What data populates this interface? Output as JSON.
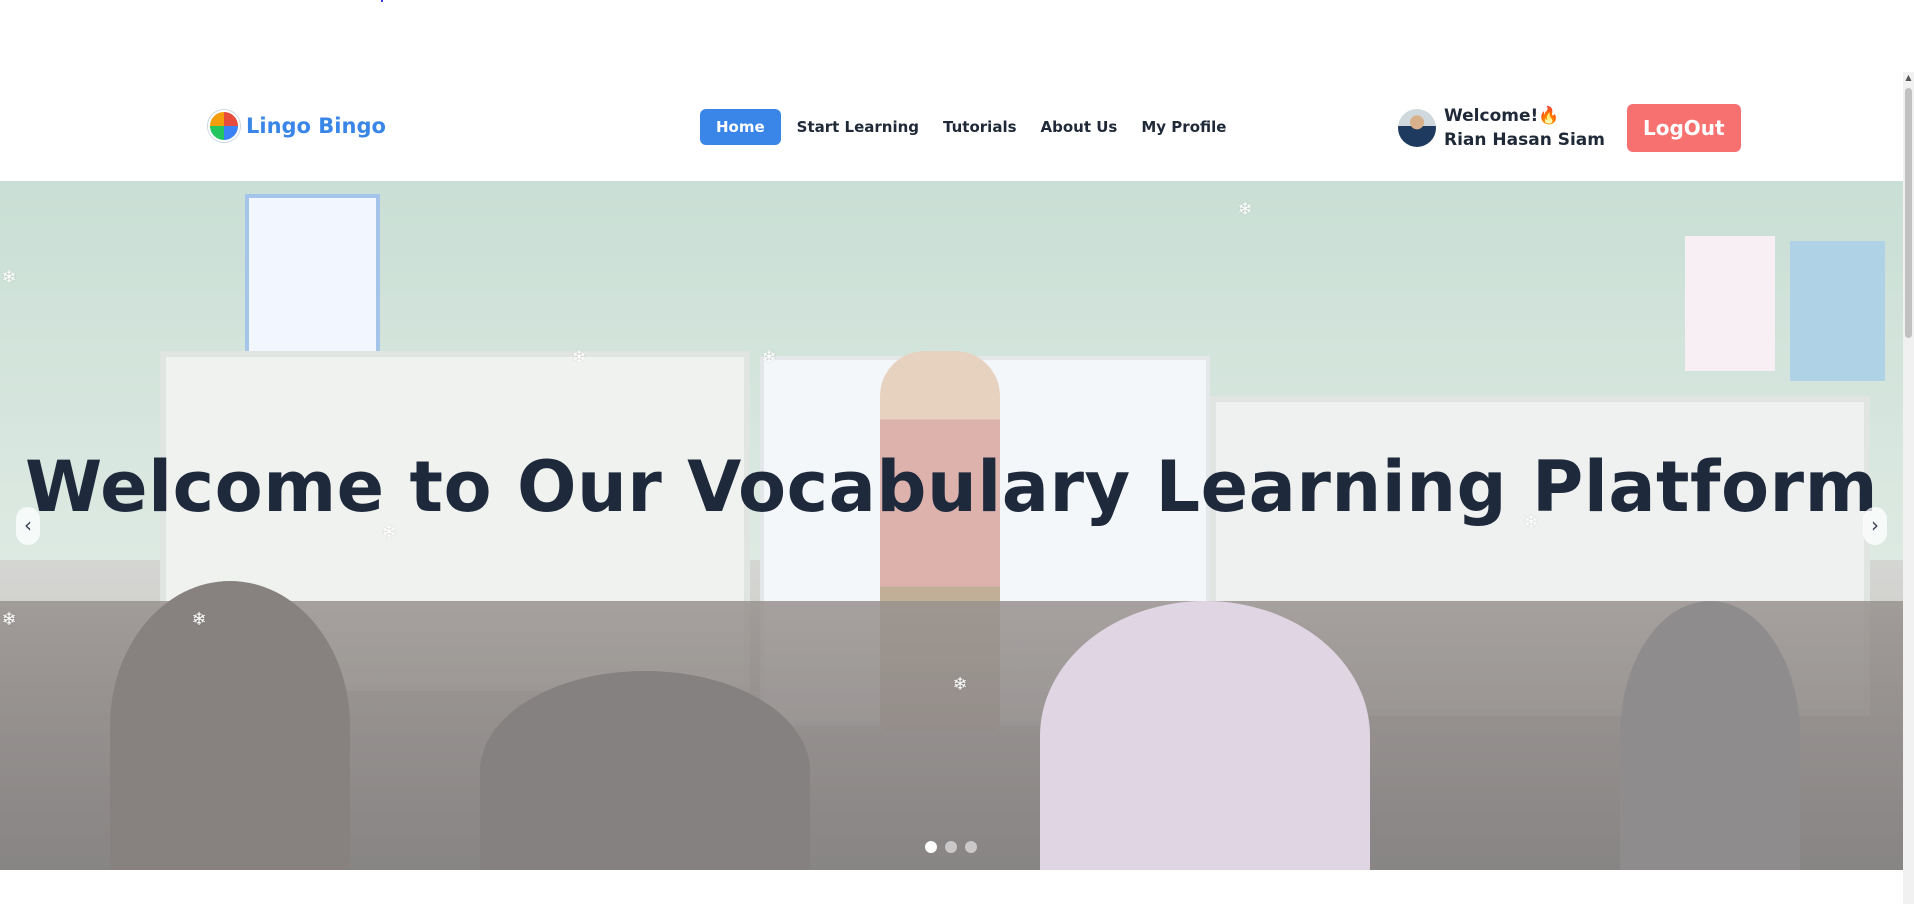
{
  "brand": {
    "name": "Lingo Bingo"
  },
  "nav": {
    "items": [
      {
        "label": "Home",
        "active": true
      },
      {
        "label": "Start Learning",
        "active": false
      },
      {
        "label": "Tutorials",
        "active": false
      },
      {
        "label": "About Us",
        "active": false
      },
      {
        "label": "My Profile",
        "active": false
      }
    ]
  },
  "user": {
    "welcome": "Welcome!",
    "name": "Rian Hasan Siam",
    "logout_label": "LogOut"
  },
  "hero": {
    "title": "Welcome to Our Vocabulary Learning Platform",
    "prev_glyph": "‹",
    "next_glyph": "›",
    "slides_total": 3,
    "active_slide": 1
  },
  "colors": {
    "accent": "#3a86e8",
    "logout": "#f87171",
    "title": "#1e293b"
  },
  "icons": {
    "logo": "globe-logo-icon",
    "fire": "fire-icon",
    "snowflake": "snowflake-icon",
    "prev": "chevron-left-icon",
    "next": "chevron-right-icon"
  }
}
